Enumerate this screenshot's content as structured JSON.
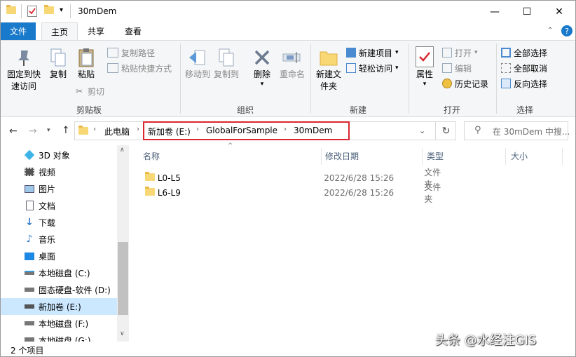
{
  "window": {
    "title": "30mDem",
    "controls": {
      "minimize": "—",
      "maximize": "☐",
      "close": "✕"
    }
  },
  "tabs": [
    "文件",
    "主页",
    "共享",
    "查看"
  ],
  "ribbon": {
    "clipboard": {
      "pin_label": "固定到快速访问",
      "copy_label": "复制",
      "paste_label": "粘贴",
      "copy_path_label": "复制路径",
      "paste_shortcut_label": "粘贴快捷方式",
      "cut_label": "剪切",
      "group_label": "剪贴板"
    },
    "organize": {
      "move_to_label": "移动到",
      "copy_to_label": "复制到",
      "delete_label": "删除",
      "rename_label": "重命名",
      "group_label": "组织"
    },
    "new": {
      "new_folder_label": "新建文件夹",
      "new_item_label": "新建项目",
      "easy_access_label": "轻松访问",
      "group_label": "新建"
    },
    "open": {
      "properties_label": "属性",
      "open_label": "打开",
      "edit_label": "编辑",
      "history_label": "历史记录",
      "group_label": "打开"
    },
    "select": {
      "select_all_label": "全部选择",
      "select_none_label": "全部取消",
      "invert_label": "反向选择",
      "group_label": "选择"
    }
  },
  "address": {
    "crumbs": [
      "此电脑",
      "新加卷 (E:)",
      "GlobalForSample",
      "30mDem"
    ],
    "search_placeholder": "在 30mDem 中搜..."
  },
  "nav": [
    {
      "label": "3D 对象",
      "icon": "cube-3d-icon"
    },
    {
      "label": "视频",
      "icon": "video-icon"
    },
    {
      "label": "图片",
      "icon": "pictures-icon"
    },
    {
      "label": "文档",
      "icon": "documents-icon"
    },
    {
      "label": "下载",
      "icon": "download-icon"
    },
    {
      "label": "音乐",
      "icon": "music-icon"
    },
    {
      "label": "桌面",
      "icon": "desktop-icon"
    },
    {
      "label": "本地磁盘 (C:)",
      "icon": "drive-icon"
    },
    {
      "label": "固态硬盘-软件 (D:)",
      "icon": "drive-icon"
    },
    {
      "label": "新加卷 (E:)",
      "icon": "drive-icon",
      "selected": true
    },
    {
      "label": "本地磁盘 (F:)",
      "icon": "drive-icon"
    },
    {
      "label": "本地磁盘 (G:)",
      "icon": "drive-icon"
    }
  ],
  "columns": {
    "name": "名称",
    "modified": "修改日期",
    "type": "类型",
    "size": "大小"
  },
  "files": [
    {
      "name": "L0-L5",
      "modified": "2022/6/28 15:26",
      "type": "文件夹"
    },
    {
      "name": "L6-L9",
      "modified": "2022/6/28 15:26",
      "type": "文件夹"
    }
  ],
  "status": "2 个项目",
  "watermark": "头条 @水经注GIS",
  "colors": {
    "accent": "#1979ca",
    "highlight_box": "#d9282f",
    "selection": "#cce8ff"
  }
}
